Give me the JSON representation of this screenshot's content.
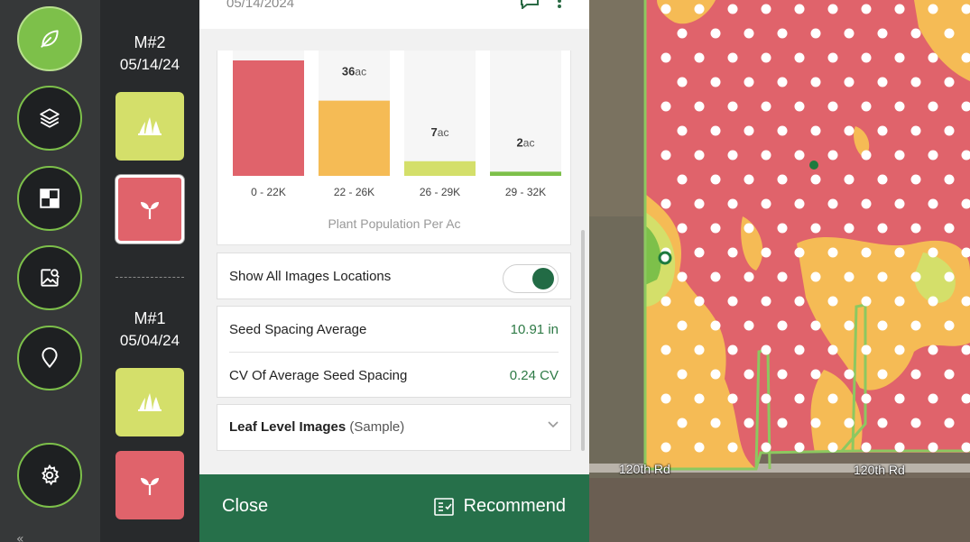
{
  "nav": {
    "items": [
      {
        "icon": "leaf-icon",
        "active": true
      },
      {
        "icon": "layers-icon",
        "active": false
      },
      {
        "icon": "grid-icon",
        "active": false
      },
      {
        "icon": "image-search-icon",
        "active": false
      },
      {
        "icon": "location-pin-icon",
        "active": false
      },
      {
        "icon": "gear-icon",
        "active": false
      }
    ],
    "collapse_glyph": "«"
  },
  "missions": [
    {
      "title": "M#2",
      "date": "05/14/24",
      "tiles": [
        {
          "type": "stand",
          "icon": "grass-icon",
          "color": "#d4df6a"
        },
        {
          "type": "population",
          "icon": "sprout-icon",
          "color": "#e0636b",
          "selected": true
        }
      ]
    },
    {
      "title": "M#1",
      "date": "05/04/24",
      "tiles": [
        {
          "type": "stand",
          "icon": "grass-icon",
          "color": "#d4df6a"
        },
        {
          "type": "population",
          "icon": "sprout-icon",
          "color": "#e0636b",
          "selected": false
        }
      ]
    }
  ],
  "panel": {
    "header_date": "05/14/2024",
    "header_icons": [
      "comment-icon",
      "more-icon"
    ],
    "show_images": {
      "label": "Show All Images Locations",
      "on": true
    },
    "seed_spacing": {
      "label": "Seed Spacing Average",
      "value": "10.91 in"
    },
    "cv_spacing": {
      "label": "CV Of Average Seed Spacing",
      "value": "0.24 CV"
    },
    "leaf_images": {
      "label": "Leaf Level Images",
      "sample": "(Sample)"
    },
    "close_label": "Close",
    "recommend_label": "Recommend"
  },
  "chart_data": {
    "type": "bar",
    "title": "",
    "xlabel": "Plant Population Per Ac",
    "ylabel": "",
    "categories": [
      "0 - 22K",
      "22 - 26K",
      "26 - 29K",
      "29 - 32K"
    ],
    "values": [
      null,
      36,
      7,
      2
    ],
    "value_labels": [
      "",
      "36",
      "7",
      "2"
    ],
    "unit": "ac",
    "colors": [
      "#e0636b",
      "#f5bb55",
      "#d4df6a",
      "#7dc04a"
    ],
    "grid": false
  },
  "map": {
    "road_labels": [
      "120th Rd",
      "120th Rd"
    ],
    "colors": {
      "low": "#e0636b",
      "mid": "#f5bb55",
      "high": "#d4df6a",
      "top": "#7dc04a",
      "outline": "#8cc860",
      "marker": "#1e7a3e"
    }
  }
}
